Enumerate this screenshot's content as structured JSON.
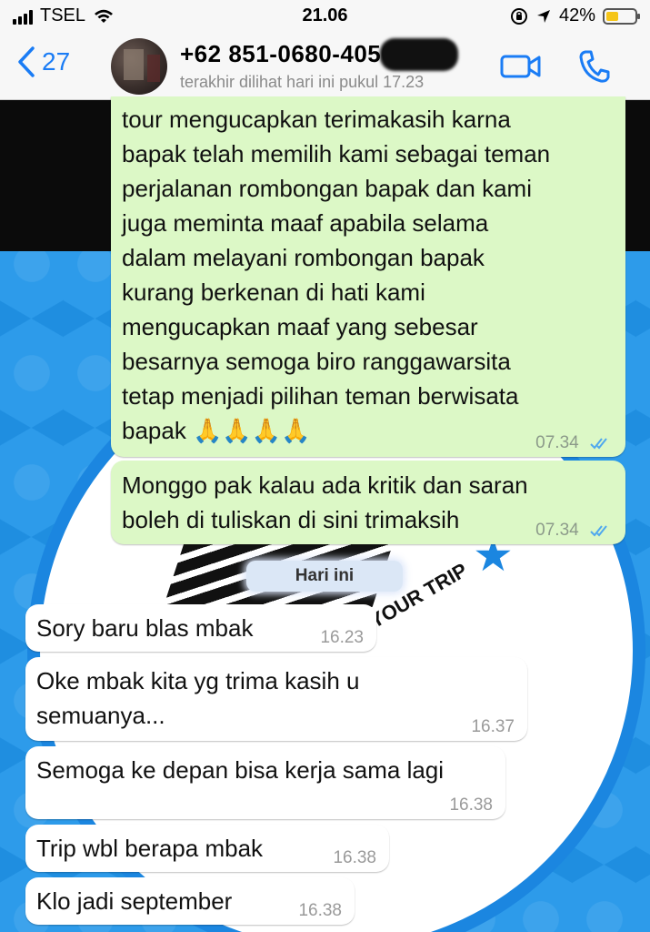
{
  "status_bar": {
    "carrier": "TSEL",
    "time": "21.06",
    "battery_percent": "42%",
    "battery_level": 0.42
  },
  "header": {
    "back_count": "27",
    "contact_name": "+62 851-0680-4050",
    "last_seen": "terakhir dilihat hari ini pukul 17.23",
    "icons": [
      "chevron-left-icon",
      "video-call-icon",
      "phone-icon"
    ],
    "accent_color": "#1a7cf5"
  },
  "messages_before": [
    {
      "direction": "out",
      "text": "tour mengucapkan terimakasih karna\nbapak telah memilih kami sebagai teman\nperjalanan rombongan bapak dan kami\njuga meminta maaf apabila selama\ndalam melayani rombongan bapak\nkurang berkenan di hati kami\nmengucapkan maaf yang sebesar\nbesarnya semoga biro ranggawarsita\ntetap menjadi pilihan teman berwisata\nbapak 🙏🙏🙏🙏",
      "time": "07.34",
      "status": "read"
    },
    {
      "direction": "out",
      "text": "Monggo pak kalau ada kritik dan saran\nboleh di tuliskan di sini trimaksih",
      "time": "07.34",
      "status": "read"
    }
  ],
  "day_separator": "Hari ini",
  "messages_today": [
    {
      "direction": "in",
      "text": "Sory baru blas mbak",
      "time": "16.23"
    },
    {
      "direction": "in",
      "text": "Oke mbak kita yg trima kasih u\nsemuanya...",
      "time": "16.37"
    },
    {
      "direction": "in",
      "text": "Semoga ke depan bisa kerja sama lagi",
      "time": "16.38"
    },
    {
      "direction": "in",
      "text": "Trip wbl berapa mbak",
      "time": "16.38"
    },
    {
      "direction": "in",
      "text": "Klo jadi september",
      "time": "16.38"
    }
  ],
  "wallpaper": {
    "logo_text": "YOUR TRIP",
    "primary_color": "#2d9bea",
    "outgoing_bubble_color": "#dcf8c6",
    "incoming_bubble_color": "#ffffff"
  }
}
